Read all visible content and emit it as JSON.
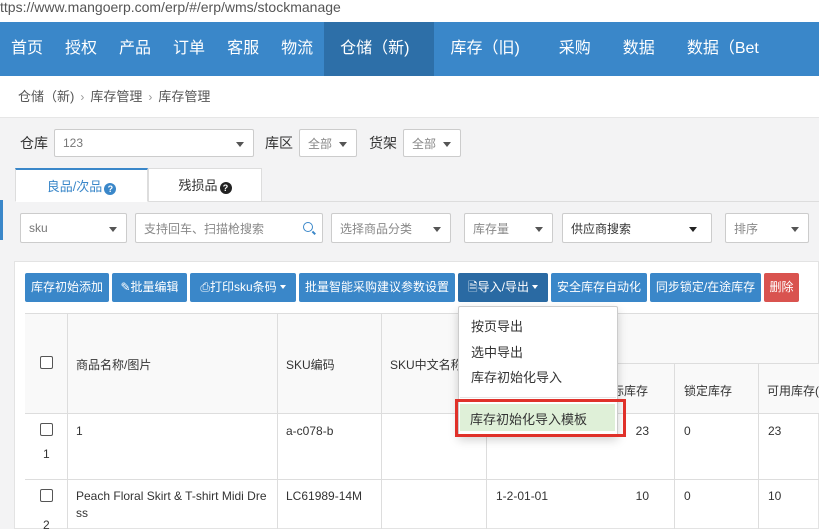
{
  "url": "ttps://www.mangoerp.com/erp/#/erp/wms/stockmanage",
  "nav": {
    "items": [
      "首页",
      "授权",
      "产品",
      "订单",
      "客服",
      "物流",
      "仓储（新)",
      "库存（旧)",
      "采购",
      "数据",
      "数据（Bet"
    ],
    "active_index": 6
  },
  "breadcrumb": [
    "仓储（新)",
    "库存管理",
    "库存管理"
  ],
  "filters": {
    "warehouse_label": "仓库",
    "warehouse_value": "123",
    "zone_label": "库区",
    "zone_value": "全部",
    "shelf_label": "货架",
    "shelf_value": "全部"
  },
  "tabs": [
    {
      "label": "良品/次品",
      "active": true
    },
    {
      "label": "残损品",
      "active": false
    }
  ],
  "search_row": {
    "sku_select": "sku",
    "search_placeholder": "支持回车、扫描枪搜索",
    "category_placeholder": "选择商品分类",
    "stock_qty_placeholder": "库存量",
    "supplier_placeholder": "供应商搜索",
    "sort_placeholder": "排序"
  },
  "toolbar": {
    "init_add": "库存初始添加",
    "batch_edit": "批量编辑",
    "print_sku": "打印sku条码",
    "smart_purchase": "批量智能采购建议参数设置",
    "import_export": "导入/导出",
    "safety_auto": "安全库存自动化",
    "sync_lock": "同步锁定/在途库存",
    "delete": "删除"
  },
  "dropdown": {
    "items": [
      "按页导出",
      "选中导出",
      "库存初始化导入",
      "库存初始化导入模板"
    ],
    "highlighted_index": 3
  },
  "table": {
    "headers": {
      "product": "商品名称/图片",
      "sku": "SKU编码",
      "sku_cn": "SKU中文名称",
      "real_stock_partial": "际库存",
      "locked_stock": "锁定库存",
      "available_stock_partial": "可用库存("
    },
    "rows": [
      {
        "index": "1",
        "product": "1",
        "sku": "a-c078-b",
        "sku_cn": "",
        "location": "",
        "real_stock": "23",
        "locked": "0",
        "available": "23"
      },
      {
        "index": "2",
        "product": "Peach Floral Skirt & T-shirt Midi Dress",
        "sku": "LC61989-14M",
        "sku_cn": "",
        "location": "1-2-01-01",
        "real_stock": "10",
        "locked": "0",
        "available": "10"
      }
    ]
  },
  "colors": {
    "primary": "#3a87c9",
    "danger": "#d9534f",
    "highlight_border": "#e0312a",
    "highlight_fill": "#dff0d8"
  }
}
